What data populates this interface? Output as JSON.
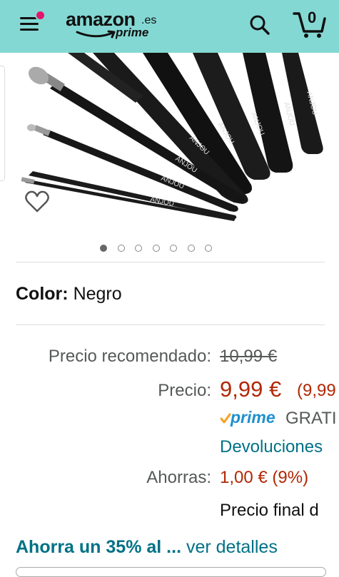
{
  "header": {
    "logo_word": "amazon",
    "logo_suffix": ".es",
    "logo_sub": "prime",
    "cart_count": "0",
    "background": "#84D8D3",
    "menu_icon": "hamburger-menu-icon",
    "notification_color": "#e3156b"
  },
  "product": {
    "image_brand": "ANJOU",
    "carousel_total": 7,
    "carousel_active": 1
  },
  "color": {
    "label": "Color:",
    "value": "Negro"
  },
  "pricing": {
    "recommended_label": "Precio recomendado:",
    "recommended_value": "10,99 €",
    "price_label": "Precio:",
    "price_value": "9,99 €",
    "price_unit": "(9,99",
    "prime_label": "prime",
    "shipping": "GRATI",
    "returns": "Devoluciones",
    "savings_label": "Ahorras:",
    "savings_value": "1,00 € (9%)",
    "final_price": "Precio final d",
    "price_color": "#B12704",
    "link_color": "#007185"
  },
  "offer": {
    "bold_text": "Ahorra un 35% a",
    "ellipsis": "l ... ",
    "link_text": "ver detalles"
  }
}
